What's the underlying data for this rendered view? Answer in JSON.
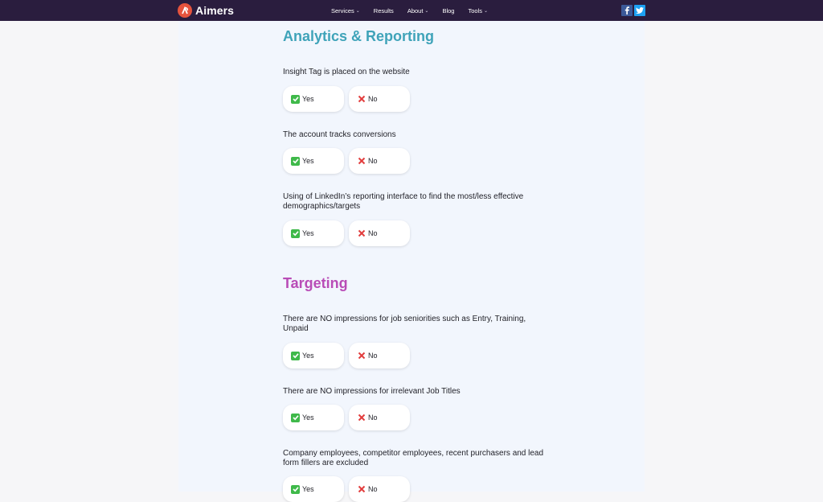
{
  "brand": {
    "name": "Aimers"
  },
  "nav": {
    "items": [
      {
        "label": "Services",
        "has_dropdown": true
      },
      {
        "label": "Results",
        "has_dropdown": false
      },
      {
        "label": "About",
        "has_dropdown": true
      },
      {
        "label": "Blog",
        "has_dropdown": false
      },
      {
        "label": "Tools",
        "has_dropdown": true
      }
    ],
    "social": [
      "facebook-icon",
      "twitter-icon"
    ]
  },
  "sections": [
    {
      "title": "Analytics & Reporting",
      "questions": [
        {
          "text": "Insight Tag is placed on the website",
          "yes": "Yes",
          "no": "No"
        },
        {
          "text": "The account tracks conversions",
          "yes": "Yes",
          "no": "No"
        },
        {
          "text": "Using of LinkedIn’s reporting interface to find the most/less effective demographics/targets",
          "yes": "Yes",
          "no": "No"
        }
      ]
    },
    {
      "title": "Targeting",
      "questions": [
        {
          "text": "There are NO impressions for job seniorities such as Entry, Training, Unpaid",
          "yes": "Yes",
          "no": "No"
        },
        {
          "text": "There are NO impressions for irrelevant Job Titles",
          "yes": "Yes",
          "no": "No"
        },
        {
          "text": "Company employees, competitor employees, recent purchasers and lead form fillers are excluded",
          "yes": "Yes",
          "no": "No"
        }
      ]
    }
  ],
  "colors": {
    "nav_bg": "#2a1d3e",
    "analytics_title": "#3fa3b9",
    "targeting_title": "#b94cb7",
    "yes_check": "#3fb94a",
    "no_cross": "#e23d3d"
  }
}
